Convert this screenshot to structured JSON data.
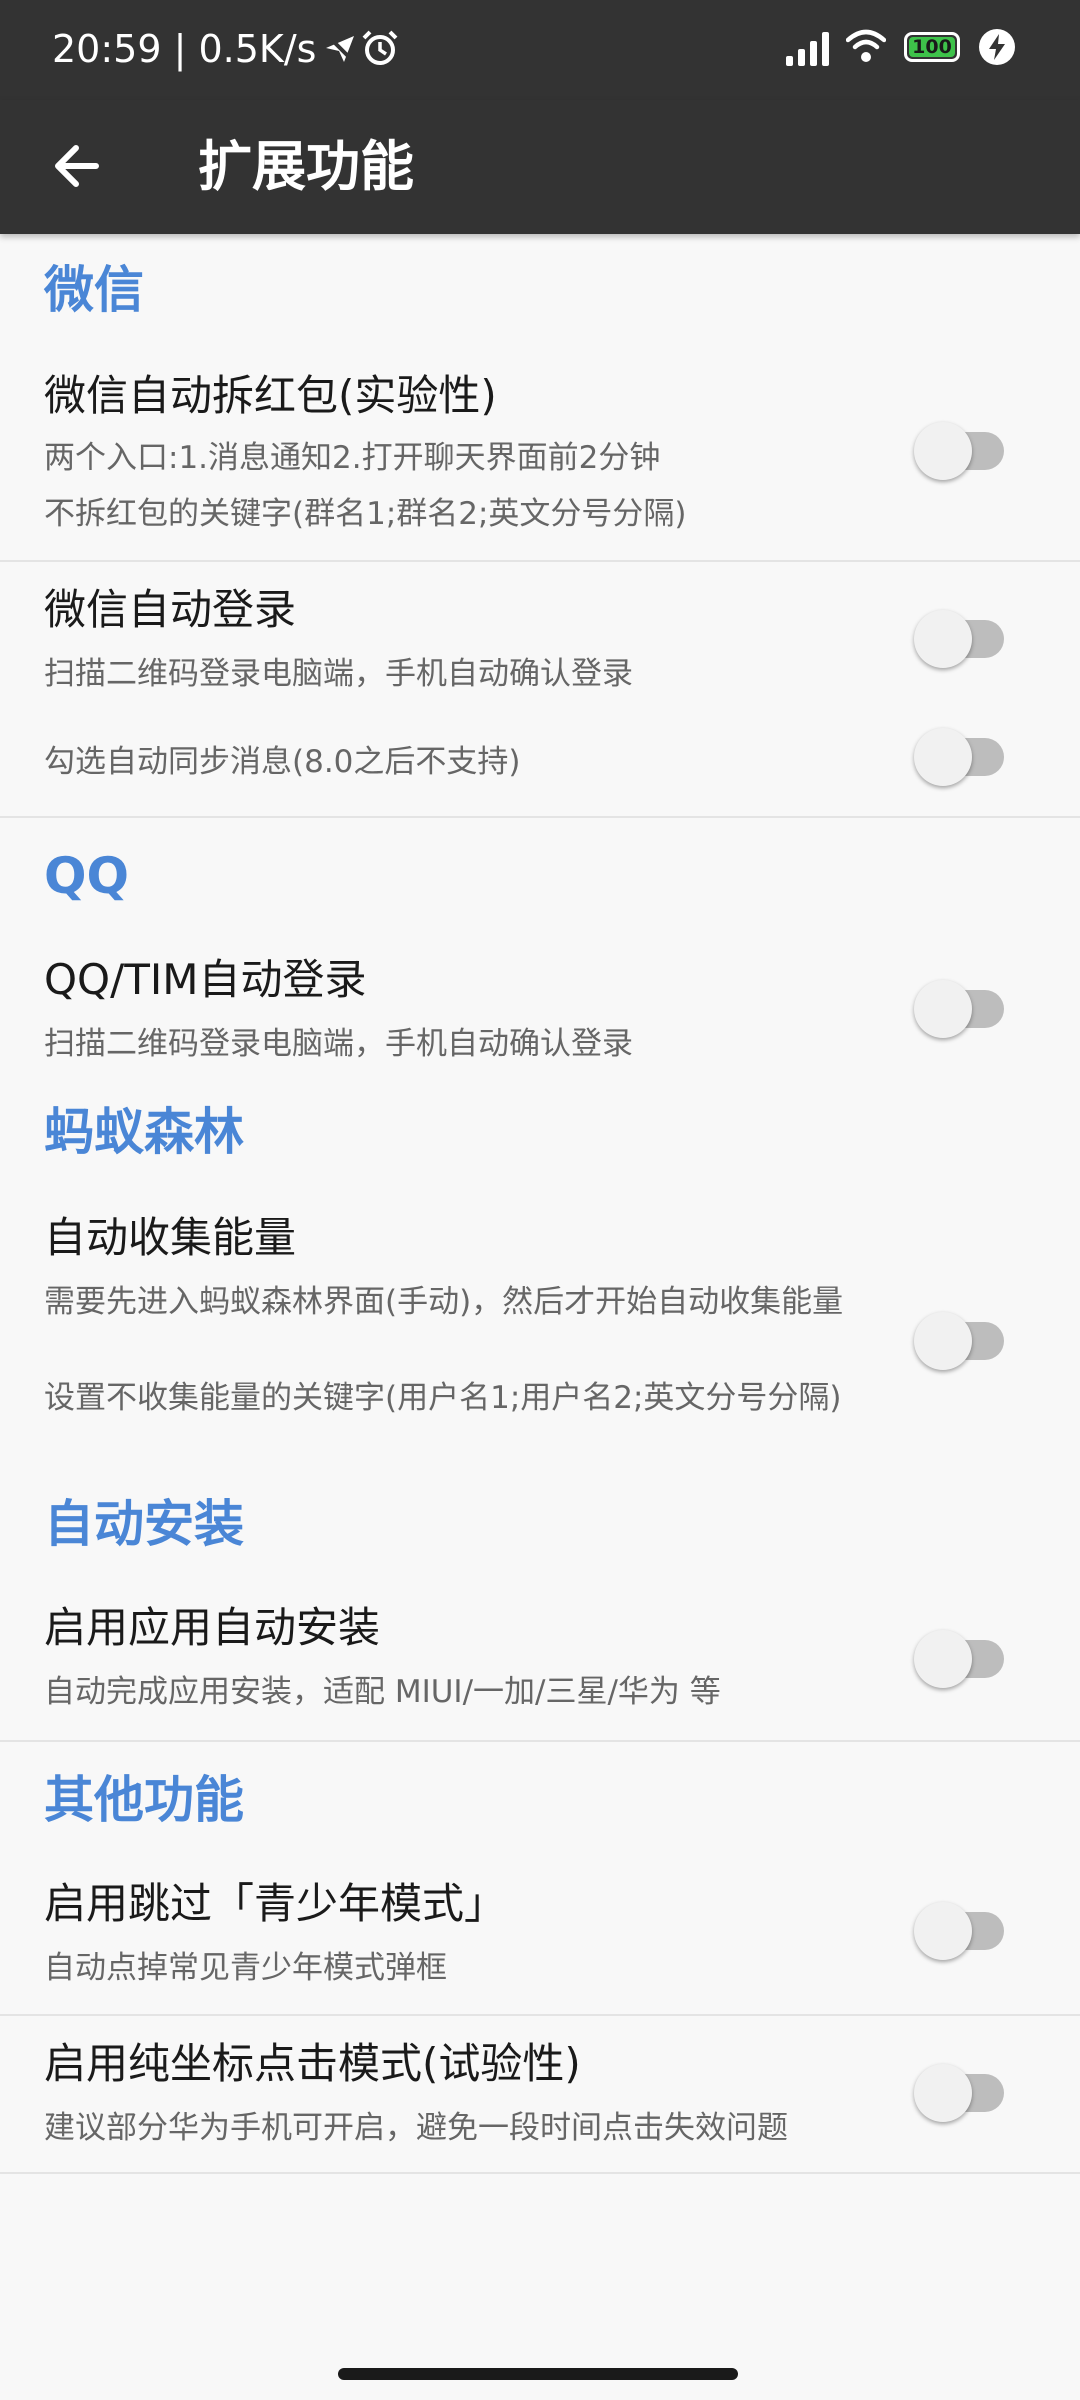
{
  "status_bar": {
    "time": "20:59 | 0.5K/s",
    "battery": "100"
  },
  "app_bar": {
    "title": "扩展功能"
  },
  "sections": {
    "wechat": "微信",
    "qq": "QQ",
    "ant_forest": "蚂蚁森林",
    "auto_install": "自动安装",
    "other": "其他功能"
  },
  "items": {
    "wechat_redpacket": {
      "title": "微信自动拆红包(实验性)",
      "desc1": "两个入口:1.消息通知2.打开聊天界面前2分钟",
      "desc2": "不拆红包的关键字(群名1;群名2;英文分号分隔)"
    },
    "wechat_login": {
      "title": "微信自动登录",
      "desc": "扫描二维码登录电脑端，手机自动确认登录",
      "sync": "勾选自动同步消息(8.0之后不支持)"
    },
    "qq_login": {
      "title": "QQ/TIM自动登录",
      "desc": "扫描二维码登录电脑端，手机自动确认登录"
    },
    "energy": {
      "title": "自动收集能量",
      "desc1": "需要先进入蚂蚁森林界面(手动)，然后才开始自动收集能量",
      "desc2": "设置不收集能量的关键字(用户名1;用户名2;英文分号分隔)"
    },
    "install": {
      "title": "启用应用自动安装",
      "desc": "自动完成应用安装，适配 MIUI/一加/三星/华为 等"
    },
    "teen_mode": {
      "title": "启用跳过「青少年模式」",
      "desc": "自动点掉常见青少年模式弹框"
    },
    "coord_click": {
      "title": "启用纯坐标点击模式(试验性)",
      "desc": "建议部分华为手机可开启，避免一段时间点击失效问题"
    }
  },
  "toggles": {
    "wechat_redpacket": false,
    "wechat_login": false,
    "wechat_sync": false,
    "qq_login": false,
    "energy": false,
    "install": false,
    "teen_mode": false,
    "coord_click": false
  },
  "colors": {
    "bar": "#333333",
    "accent": "#4a86d6",
    "background": "#f8f8f8",
    "switch_off_track": "#bdbdbd"
  }
}
